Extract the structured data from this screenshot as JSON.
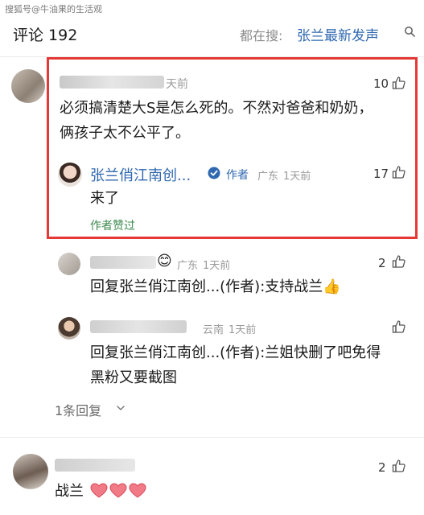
{
  "watermark": "搜狐号@牛油果的生活观",
  "header": {
    "comments_label": "评论 192",
    "everyone_searching": "都在搜:",
    "hot_search": "张兰最新发声"
  },
  "comments": [
    {
      "username_partial": "天前",
      "likes": "10",
      "text_line1": "必须搞清楚大S是怎么死的。不然对爸爸和奶奶，",
      "text_line2": "俩孩子太不公平了。",
      "author_reply": {
        "username": "张兰俏江南创...",
        "badge": "作者",
        "location": "广东",
        "time": "1天前",
        "likes": "17",
        "text": "来了",
        "liked_label": "作者赞过"
      }
    }
  ],
  "replies": [
    {
      "location": "广东",
      "time": "1天前",
      "likes": "2",
      "reply_to": "回复张兰俏江南创...(作者):",
      "text": "支持战兰👍"
    },
    {
      "location": "云南",
      "time": "1天前",
      "reply_to": "回复张兰俏江南创...(作者):",
      "text_line1": "兰姐快删了吧免得",
      "text_line2": "黑粉又要截图"
    }
  ],
  "more_replies": "1条回复",
  "last_comment": {
    "likes": "2",
    "text": "战兰"
  },
  "colors": {
    "highlight_border": "#e53935",
    "link_blue": "#2f68b0",
    "liked_green": "#3c8a4e",
    "meta_gray": "#9a9a9a"
  }
}
